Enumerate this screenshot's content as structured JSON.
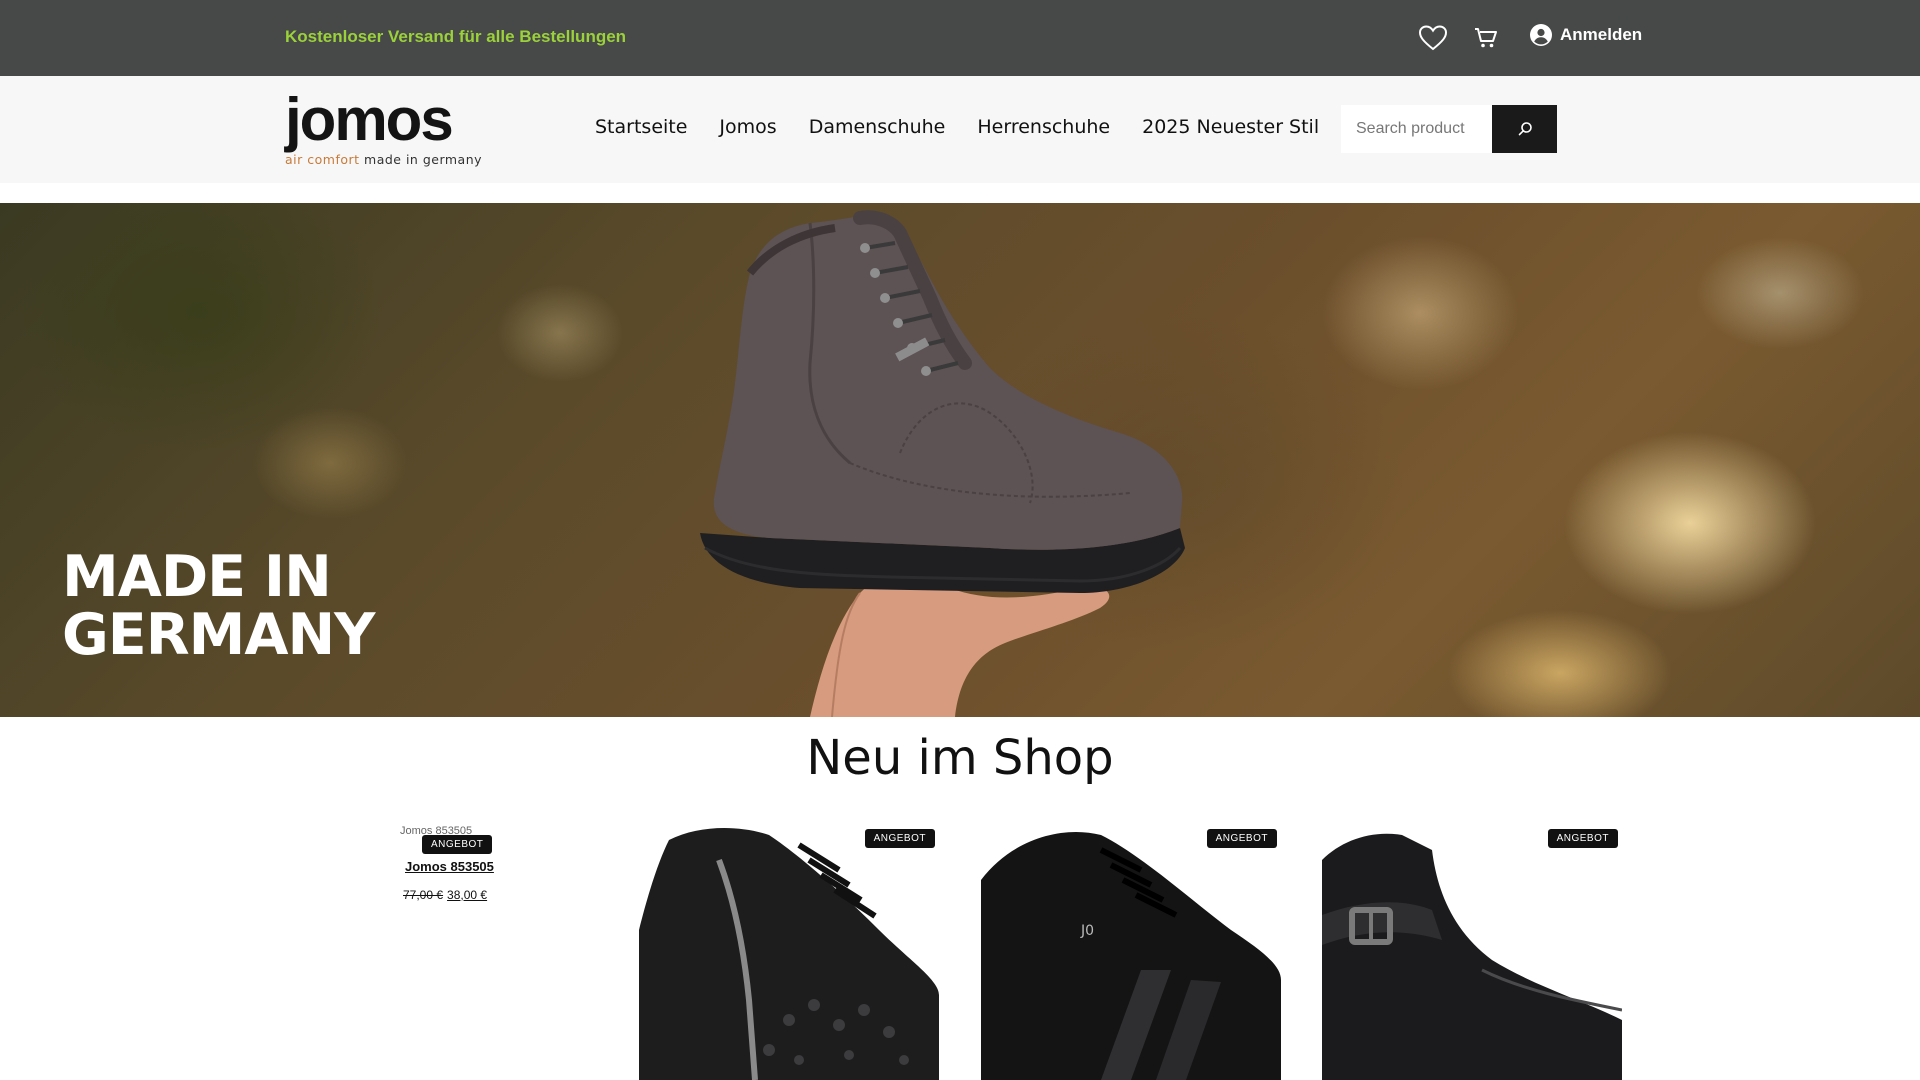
{
  "topbar": {
    "promo": "Kostenloser Versand für alle Bestellungen",
    "login_label": "Anmelden",
    "icons": [
      "heart-icon",
      "cart-icon",
      "user-icon"
    ]
  },
  "header": {
    "logo_word": "jomos",
    "logo_tag_accent": "air comfort",
    "logo_tag_rest": "made in germany",
    "nav": [
      "Startseite",
      "Jomos",
      "Damenschuhe",
      "Herrenschuhe",
      "2025 Neuester Stil"
    ],
    "search_placeholder": "Search product"
  },
  "hero": {
    "line1": "MADE IN",
    "line2": "GERMANY"
  },
  "section": {
    "title": "Neu im Shop"
  },
  "products": [
    {
      "badge": "ANGEBOT",
      "alt": "Jomos 853505",
      "name": "Jomos 853505",
      "old_price": "77,00 €",
      "price": "38,00 €"
    },
    {
      "badge": "ANGEBOT"
    },
    {
      "badge": "ANGEBOT"
    },
    {
      "badge": "ANGEBOT"
    }
  ],
  "colors": {
    "topbar_bg": "#474848",
    "promo_green": "#9bd13a",
    "header_bg": "#f7f7f7",
    "search_button": "#1a1a1a",
    "badge_bg": "#111111"
  }
}
